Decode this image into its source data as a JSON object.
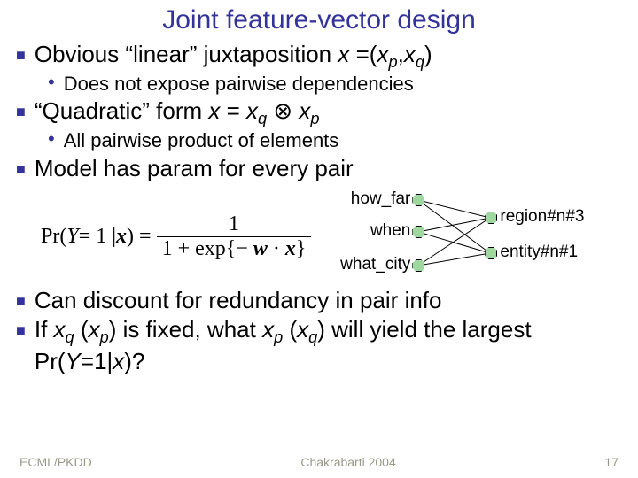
{
  "title": "Joint feature-vector design",
  "bullets": {
    "b1_pre": "Obvious “linear” juxtaposition ",
    "b1_expr": {
      "x": "x ",
      "eq": "=(",
      "xp": "x",
      "p": "p",
      "comma": ",",
      "xq": "x",
      "q": "q",
      "close": ")"
    },
    "b1s1": "Does not expose pairwise dependencies",
    "b2_pre": "“Quadratic” form ",
    "b2_expr": {
      "x": "x",
      "eq": " = ",
      "xq": "x",
      "q": "q",
      "tensor": " ⊗ ",
      "xp": "x",
      "p": "p"
    },
    "b2s1": "All pairwise product of elements",
    "b3": "Model has param for every pair",
    "b4": "Can discount for redundancy in pair info",
    "b5_pre": "If ",
    "b5_xq": "x",
    "b5_q": "q",
    "b5_lp": " (",
    "b5_xp": "x",
    "b5_p": "p",
    "b5_mid": ") is fixed, what ",
    "b5_xp2": "x",
    "b5_p2": "p",
    "b5_lp2": " (",
    "b5_xq2": "x",
    "b5_q2": "q",
    "b5_after": ") will yield the largest Pr(",
    "b5_Y": "Y",
    "b5_eqv": "=1|",
    "b5_x": "x",
    "b5_end": ")?"
  },
  "formula": {
    "lhs1": "Pr(",
    "Y": "Y",
    "mid1": " = 1 | ",
    "x": "x",
    "rp": ") = ",
    "num": "1",
    "den_pre": "1 + exp{− ",
    "w": "w",
    "dot": " · ",
    "xx": "x",
    "den_post": "}"
  },
  "network": {
    "left": [
      "how_far",
      "when",
      "what_city"
    ],
    "right": [
      "region#n#3",
      "entity#n#1"
    ]
  },
  "footer": {
    "left": "ECML/PKDD",
    "center": "Chakrabarti 2004",
    "right": "17"
  }
}
